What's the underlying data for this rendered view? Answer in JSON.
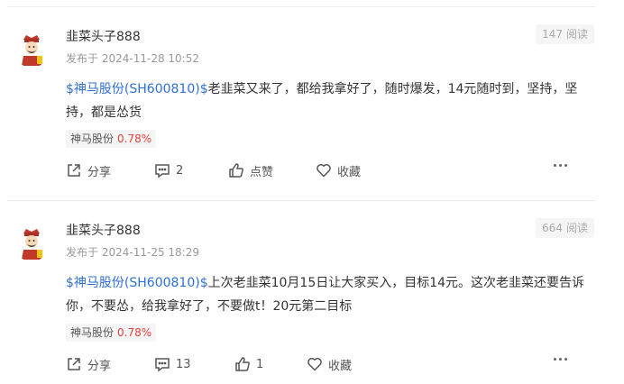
{
  "posts": [
    {
      "username": "韭菜头子888",
      "pub_label": "发布于",
      "date": "2024-11-28 10:52",
      "read_count": "147",
      "read_label": "阅读",
      "stock_link": "$神马股份(SH600810)$",
      "content_line1": "老韭菜又来了，都给我拿好了，随时爆发，14元随时到，坚持，坚",
      "content_line2": "持，都是怂货",
      "tag_name": "神马股份",
      "tag_change": "0.78%",
      "share_label": "分享",
      "comment_count": "2",
      "like_label": "点赞",
      "collect_label": "收藏"
    },
    {
      "username": "韭菜头子888",
      "pub_label": "发布于",
      "date": "2024-11-25 18:29",
      "read_count": "664",
      "read_label": "阅读",
      "stock_link": "$神马股份(SH600810)$",
      "content_line1": "上次老韭菜10月15日让大家买入，目标14元。这次老韭菜还要告诉",
      "content_line2": "你，不要怂，给我拿好了，不要做t！20元第二目标",
      "tag_name": "神马股份",
      "tag_change": "0.78%",
      "share_label": "分享",
      "comment_count": "13",
      "like_count": "1",
      "collect_label": "收藏"
    }
  ],
  "colors": {
    "link": "#2f6fd8",
    "up_change": "#e0413a",
    "muted": "#999999"
  },
  "icons": [
    "avatar-caishen",
    "share-icon",
    "comment-icon",
    "like-icon",
    "collect-heart-icon",
    "more-icon"
  ]
}
